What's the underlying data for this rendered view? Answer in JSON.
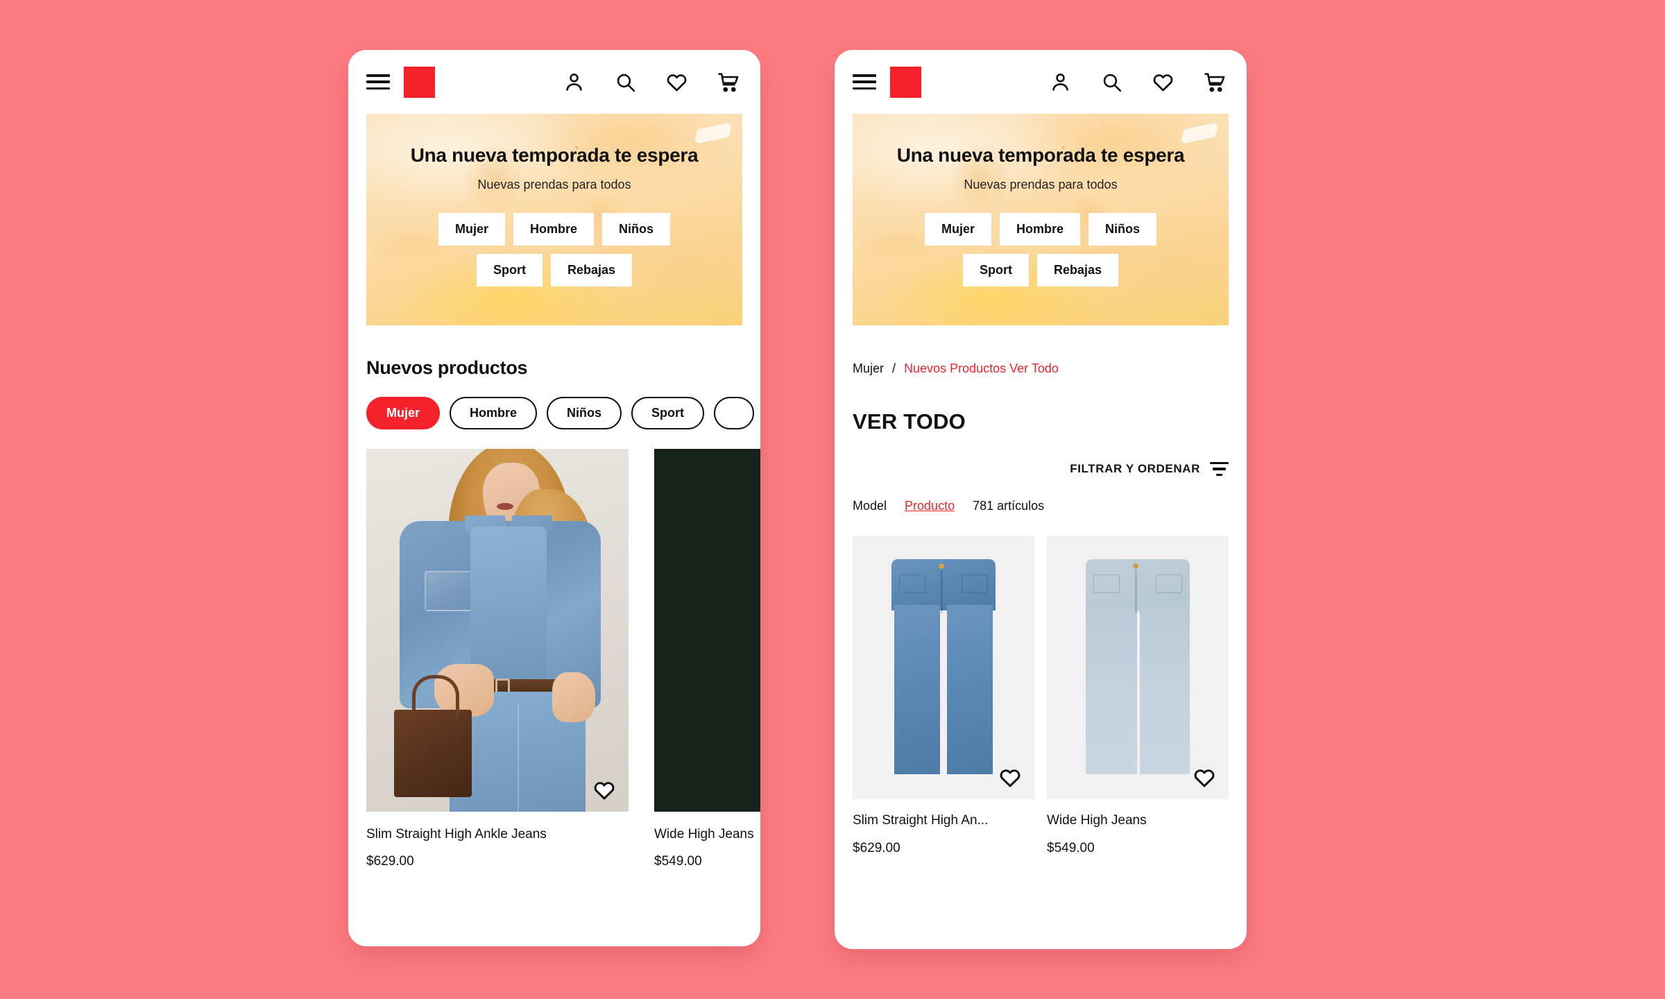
{
  "theme": {
    "page_background": "#FD7C83",
    "brand_red": "#F5222B",
    "text_dark": "#111111",
    "card_background": "#F1F1F1"
  },
  "header": {
    "menu_icon": "hamburger-menu-icon",
    "logo": "red-square-logo",
    "icons": [
      "account-person-icon",
      "search-icon",
      "heart-wishlist-icon",
      "shopping-cart-icon"
    ]
  },
  "hero": {
    "title": "Una nueva temporada te espera",
    "subtitle": "Nuevas prendas para todos",
    "buttons": [
      "Mujer",
      "Hombre",
      "Niños",
      "Sport",
      "Rebajas"
    ]
  },
  "left_screen": {
    "section_title": "Nuevos productos",
    "chips": [
      {
        "label": "Mujer",
        "active": true
      },
      {
        "label": "Hombre",
        "active": false
      },
      {
        "label": "Niños",
        "active": false
      },
      {
        "label": "Sport",
        "active": false
      },
      {
        "label": "",
        "active": false
      }
    ],
    "products": [
      {
        "name": "Slim Straight High Ankle Jeans",
        "price": "$629.00",
        "favorite_icon": "heart-outline-icon"
      },
      {
        "name": "Wide High Jeans",
        "price": "$549.00",
        "favorite_icon": "heart-outline-icon"
      }
    ]
  },
  "right_screen": {
    "breadcrumb": {
      "root": "Mujer",
      "separator": "/",
      "current": "Nuevos Productos Ver Todo"
    },
    "page_title": "VER TODO",
    "filter_button": {
      "label": "FILTRAR Y ORDENAR",
      "icon": "filter-sort-icon"
    },
    "sort_bar": {
      "model_label": "Model",
      "producto_label": "Producto",
      "count": "781 artículos"
    },
    "products": [
      {
        "name": "Slim Straight High An...",
        "price": "$629.00",
        "favorite_icon": "heart-outline-icon"
      },
      {
        "name": "Wide High Jeans",
        "price": "$549.00",
        "favorite_icon": "heart-outline-icon"
      }
    ]
  }
}
